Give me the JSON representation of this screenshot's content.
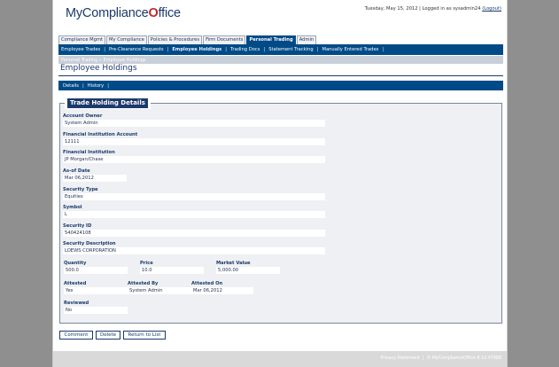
{
  "header": {
    "logo_text": "MyCompliance",
    "logo_mark": "O",
    "logo_suffix": "ffice",
    "date_text": "Tuesday, May 15, 2012",
    "login_prefix": "Logged in as",
    "username": "sysadmin24",
    "logout_label": "(Logout)"
  },
  "tabs": [
    {
      "label": "Compliance Mgmt"
    },
    {
      "label": "My Compliance"
    },
    {
      "label": "Policies & Procedures"
    },
    {
      "label": "Firm Documents"
    },
    {
      "label": "Personal Trading"
    },
    {
      "label": "Admin"
    }
  ],
  "subnav": [
    {
      "label": "Employee Trades"
    },
    {
      "label": "Pre-Clearance Requests"
    },
    {
      "label": "Employee Holdings"
    },
    {
      "label": "Trading Docs"
    },
    {
      "label": "Statement Tracking"
    },
    {
      "label": "Manually Entered Trades"
    }
  ],
  "breadcrumb": {
    "parent": "Personal Trading",
    "separator": "»",
    "current": "Employee Holdings"
  },
  "page_title": "Employee Holdings",
  "detail_nav": [
    {
      "label": "Details"
    },
    {
      "label": "History"
    }
  ],
  "section_title": "Trade Holding Details",
  "fields": {
    "account_owner": {
      "label": "Account Owner",
      "value": "System Admin"
    },
    "fi_account": {
      "label": "Financial Institution Account",
      "value": "12111"
    },
    "fi": {
      "label": "Financial Institution",
      "value": "JP Morgan/Chase"
    },
    "as_of_date": {
      "label": "As-of Date",
      "value": "Mar 06,2012"
    },
    "security_type": {
      "label": "Security Type",
      "value": "Equities"
    },
    "symbol": {
      "label": "Symbol",
      "value": "L"
    },
    "security_id": {
      "label": "Security ID",
      "value": "540424108"
    },
    "security_description": {
      "label": "Security Description",
      "value": "LOEWS CORPORATION"
    },
    "quantity": {
      "label": "Quantity",
      "value": "500.0"
    },
    "price": {
      "label": "Price",
      "value": "10.0"
    },
    "market_value": {
      "label": "Market Value",
      "value": "5,000.00"
    },
    "attested": {
      "label": "Attested",
      "value": "Yes"
    },
    "attested_by": {
      "label": "Attested By",
      "value": "System Admin"
    },
    "attested_on": {
      "label": "Attested On",
      "value": "Mar 06,2012"
    },
    "reviewed": {
      "label": "Reviewed",
      "value": "No"
    }
  },
  "buttons": {
    "comment": "Comment",
    "delete": "Delete",
    "return": "Return to List"
  },
  "footer": {
    "privacy": "Privacy Statement",
    "copyright": "© MyComplianceOffice 6.10.47888"
  },
  "colors": {
    "nav_blue": "#004b87",
    "title_blue": "#1b3a6b",
    "logo_check_red": "#c0282b",
    "panel_bg": "#eef0f4"
  }
}
